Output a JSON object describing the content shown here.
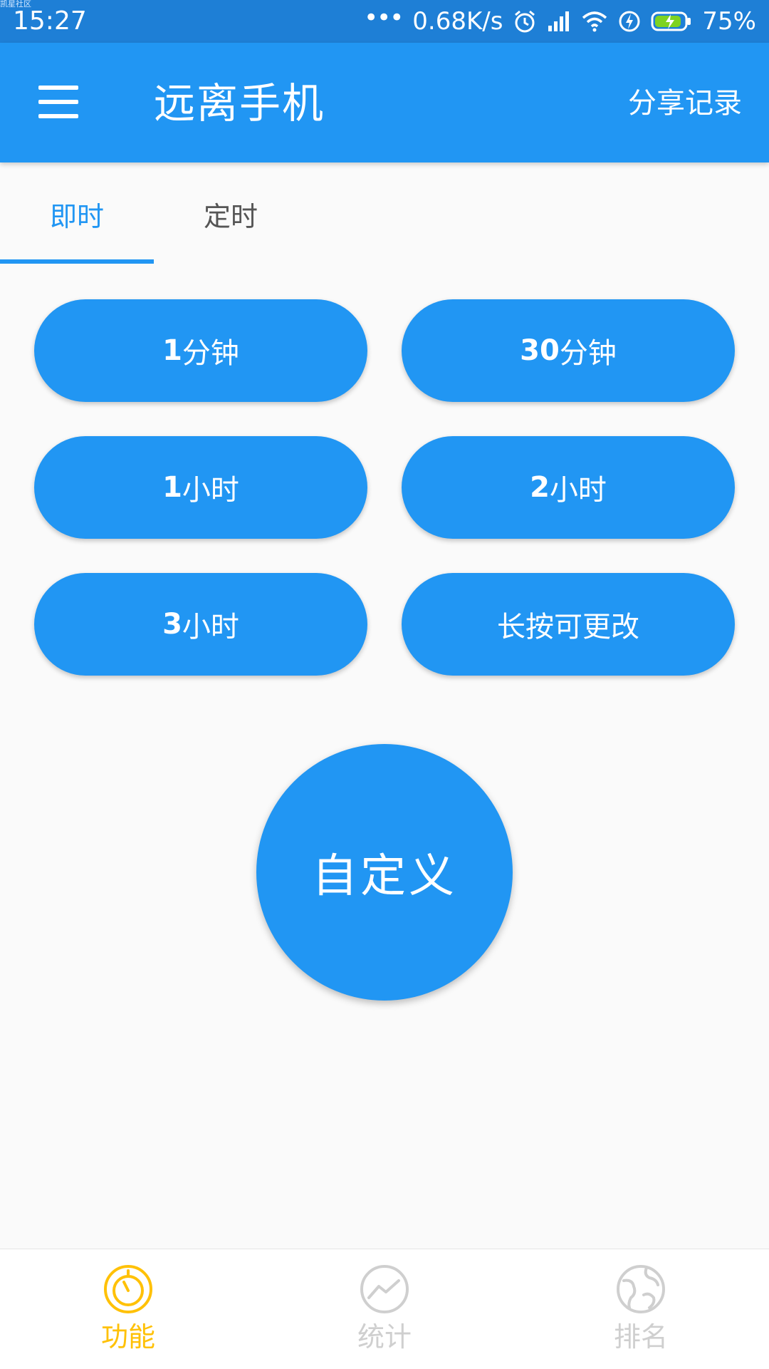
{
  "status_bar": {
    "tiny_text": "凯星社区",
    "time": "15:27",
    "dots": "•••",
    "net_speed": "0.68K/s",
    "battery": "75%"
  },
  "app_bar": {
    "title": "远离手机",
    "share_label": "分享记录"
  },
  "tabs": [
    {
      "label": "即时",
      "active": true
    },
    {
      "label": "定时",
      "active": false
    }
  ],
  "presets": [
    {
      "num": "1",
      "unit": "分钟"
    },
    {
      "num": "30",
      "unit": "分钟"
    },
    {
      "num": "1",
      "unit": "小时"
    },
    {
      "num": "2",
      "unit": "小时"
    },
    {
      "num": "3",
      "unit": "小时"
    },
    {
      "num": "",
      "unit": "长按可更改"
    }
  ],
  "custom_button": "自定义",
  "bottom_nav": [
    {
      "label": "功能",
      "icon": "timer-icon",
      "active": true
    },
    {
      "label": "统计",
      "icon": "chart-icon",
      "active": false
    },
    {
      "label": "排名",
      "icon": "globe-icon",
      "active": false
    }
  ],
  "colors": {
    "primary": "#2196f3",
    "status_bar": "#1e7fd6",
    "nav_active": "#ffc107",
    "nav_inactive": "#cfcfcf"
  }
}
